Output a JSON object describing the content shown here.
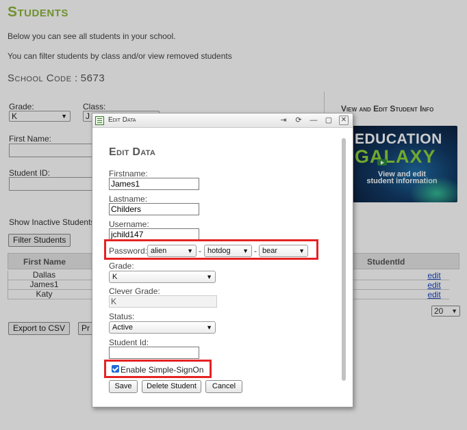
{
  "page": {
    "title": "Students",
    "intro1": "Below you can see all students in your school.",
    "intro2": "You can filter students by class and/or view removed students",
    "school_code_label": "School Code :",
    "school_code": "5673"
  },
  "filters": {
    "grade_label": "Grade:",
    "grade_value": "K",
    "class_label": "Class:",
    "class_value": "J",
    "first_name_label": "First Name:",
    "student_id_label": "Student ID:",
    "inactive_label": "Show Inactive Students",
    "filter_button": "Filter Students"
  },
  "sidebar": {
    "title": "View and Edit Student Info",
    "banner_line1": "EDUCATION",
    "banner_line2": "GALAXY",
    "banner_caption": "View and edit student information"
  },
  "table": {
    "columns": {
      "first_name": "First Name",
      "student_id": "StudentId"
    },
    "rows": [
      {
        "first_name": "Dallas",
        "action": "edit"
      },
      {
        "first_name": "James1",
        "action": "edit"
      },
      {
        "first_name": "Katy",
        "action": "edit"
      }
    ],
    "page_size": "20"
  },
  "footer": {
    "export_button": "Export to CSV",
    "print_button_partial": "Pr"
  },
  "dialog": {
    "titlebar": "Edit Data",
    "heading": "Edit Data",
    "firstname_label": "Firstname:",
    "firstname_value": "James1",
    "lastname_label": "Lastname:",
    "lastname_value": "Childers",
    "username_label": "Username:",
    "username_value": "jchild147",
    "password_label": "Password:",
    "password_word1": "alien",
    "password_word2": "hotdog",
    "password_word3": "bear",
    "password_sep": "-",
    "grade_label": "Grade:",
    "grade_value": "K",
    "clever_grade_label": "Clever Grade:",
    "clever_grade_value": "K",
    "status_label": "Status:",
    "status_value": "Active",
    "student_id_label": "Student Id:",
    "student_id_value": "",
    "sso_label": "Enable Simple-SignOn",
    "sso_checked": true,
    "save_button": "Save",
    "delete_button": "Delete Student",
    "cancel_button": "Cancel"
  },
  "colors": {
    "title_green": "#8db63c",
    "highlight_red": "#e52222",
    "link_blue": "#1a47c4"
  },
  "icons": {
    "window": "form-window-icon",
    "titlebar_controls": [
      "pin-icon",
      "refresh-icon",
      "minimize-icon",
      "maximize-icon",
      "close-icon"
    ],
    "banner_play": "play-icon"
  }
}
